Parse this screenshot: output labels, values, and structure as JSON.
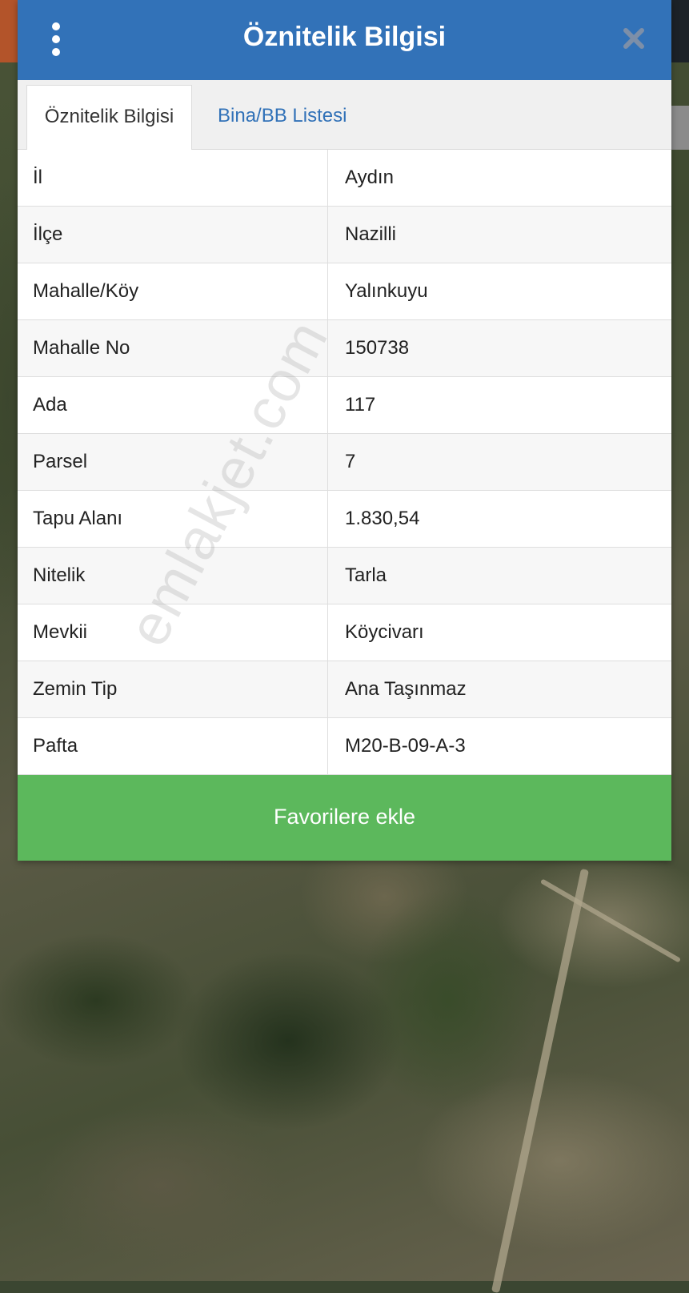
{
  "dialog": {
    "title": "Öznitelik Bilgisi",
    "menu_icon": "kebab-menu-icon",
    "close_icon": "close-icon"
  },
  "tabs": [
    {
      "label": "Öznitelik Bilgisi",
      "active": true
    },
    {
      "label": "Bina/BB Listesi",
      "active": false
    }
  ],
  "attributes": [
    {
      "label": "İl",
      "value": "Aydın"
    },
    {
      "label": "İlçe",
      "value": "Nazilli"
    },
    {
      "label": "Mahalle/Köy",
      "value": "Yalınkuyu"
    },
    {
      "label": "Mahalle No",
      "value": "150738"
    },
    {
      "label": "Ada",
      "value": "117"
    },
    {
      "label": "Parsel",
      "value": "7"
    },
    {
      "label": "Tapu Alanı",
      "value": "1.830,54"
    },
    {
      "label": "Nitelik",
      "value": "Tarla"
    },
    {
      "label": "Mevkii",
      "value": "Köycivarı"
    },
    {
      "label": "Zemin Tip",
      "value": "Ana Taşınmaz"
    },
    {
      "label": "Pafta",
      "value": "M20-B-09-A-3"
    }
  ],
  "actions": {
    "favorite_label": "Favorilere ekle"
  },
  "watermark": "emlakjet.com",
  "colors": {
    "header": "#3272b8",
    "button": "#5cb85c",
    "tab_link": "#3272b8"
  }
}
